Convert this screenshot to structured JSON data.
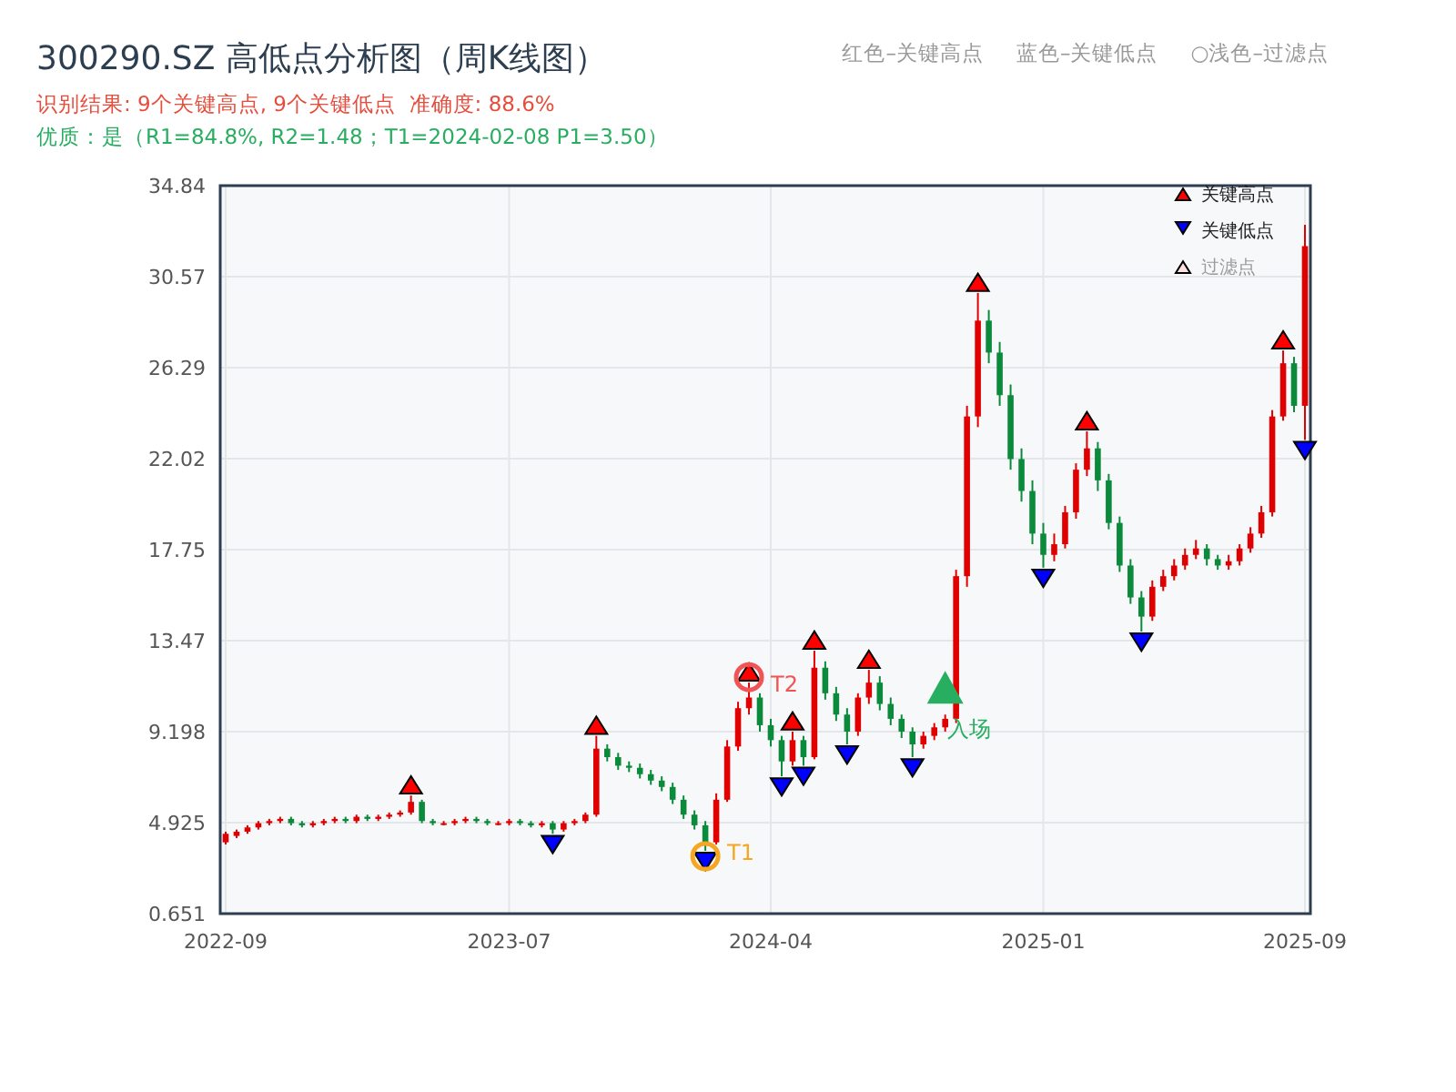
{
  "header": {
    "title": "300290.SZ 高低点分析图（周K线图）",
    "result": "识别结果: 9个关键高点, 9个关键低点  准确度: 88.6%",
    "quality": "优质：是（R1=84.8%, R2=1.48；T1=2024-02-08 P1=3.50）"
  },
  "hints": [
    {
      "label": "红色–关键高点"
    },
    {
      "label": "蓝色–关键低点"
    },
    {
      "label": "○浅色–过滤点"
    }
  ],
  "filtered_legend": {
    "label": "过滤点"
  },
  "chart_data": {
    "type": "candlestick",
    "ylim": [
      0.651,
      34.84
    ],
    "grid": true,
    "legend": "upper right",
    "categories": [
      "2022-09",
      null,
      null,
      null,
      null,
      null,
      null,
      null,
      null,
      null,
      null,
      null,
      null,
      null,
      null,
      null,
      null,
      null,
      null,
      null,
      null,
      null,
      null,
      null,
      null,
      null,
      "2023-07",
      null,
      null,
      null,
      null,
      null,
      null,
      null,
      null,
      null,
      null,
      null,
      null,
      null,
      null,
      null,
      null,
      null,
      null,
      null,
      null,
      null,
      null,
      null,
      "2024-04",
      null,
      null,
      null,
      null,
      null,
      null,
      null,
      null,
      null,
      null,
      null,
      null,
      null,
      null,
      null,
      null,
      null,
      null,
      null,
      null,
      null,
      null,
      null,
      null,
      "2025-01",
      null,
      null,
      null,
      null,
      null,
      null,
      null,
      null,
      null,
      null,
      null,
      null,
      null,
      null,
      null,
      null,
      null,
      null,
      null,
      null,
      null,
      null,
      null,
      "2025-09"
    ],
    "yticks": [
      0.651,
      4.925,
      9.198,
      13.47,
      17.75,
      22.02,
      26.29,
      30.57,
      34.84
    ],
    "ohlc": [
      [
        4.0,
        4.5,
        3.9,
        4.4
      ],
      [
        4.3,
        4.6,
        4.2,
        4.5
      ],
      [
        4.5,
        4.8,
        4.4,
        4.7
      ],
      [
        4.7,
        5.0,
        4.6,
        4.9
      ],
      [
        4.9,
        5.1,
        4.8,
        5.0
      ],
      [
        5.0,
        5.2,
        4.9,
        5.1
      ],
      [
        5.1,
        5.2,
        4.8,
        4.9
      ],
      [
        4.9,
        5.0,
        4.7,
        4.8
      ],
      [
        4.8,
        5.0,
        4.7,
        4.9
      ],
      [
        4.9,
        5.1,
        4.8,
        5.0
      ],
      [
        5.0,
        5.2,
        4.9,
        5.1
      ],
      [
        5.1,
        5.2,
        4.9,
        5.0
      ],
      [
        5.0,
        5.3,
        4.9,
        5.2
      ],
      [
        5.2,
        5.3,
        5.0,
        5.1
      ],
      [
        5.1,
        5.3,
        5.0,
        5.2
      ],
      [
        5.2,
        5.4,
        5.1,
        5.3
      ],
      [
        5.3,
        5.5,
        5.2,
        5.4
      ],
      [
        5.4,
        6.2,
        5.3,
        5.9
      ],
      [
        5.9,
        6.0,
        4.9,
        5.0
      ],
      [
        5.0,
        5.1,
        4.8,
        4.9
      ],
      [
        4.9,
        5.0,
        4.8,
        4.9
      ],
      [
        4.9,
        5.1,
        4.8,
        5.0
      ],
      [
        5.0,
        5.2,
        4.9,
        5.1
      ],
      [
        5.1,
        5.2,
        4.9,
        5.0
      ],
      [
        5.0,
        5.1,
        4.8,
        4.9
      ],
      [
        4.9,
        5.0,
        4.8,
        4.9
      ],
      [
        4.9,
        5.1,
        4.8,
        5.0
      ],
      [
        5.0,
        5.1,
        4.8,
        4.9
      ],
      [
        4.9,
        5.0,
        4.7,
        4.8
      ],
      [
        4.8,
        5.0,
        4.7,
        4.9
      ],
      [
        4.9,
        5.0,
        4.4,
        4.6
      ],
      [
        4.6,
        5.0,
        4.5,
        4.9
      ],
      [
        4.9,
        5.1,
        4.8,
        5.0
      ],
      [
        5.0,
        5.4,
        4.9,
        5.3
      ],
      [
        5.3,
        9.0,
        5.2,
        8.4
      ],
      [
        8.4,
        8.6,
        7.8,
        8.0
      ],
      [
        8.0,
        8.2,
        7.4,
        7.6
      ],
      [
        7.6,
        7.8,
        7.3,
        7.5
      ],
      [
        7.5,
        7.7,
        7.0,
        7.2
      ],
      [
        7.2,
        7.4,
        6.7,
        6.9
      ],
      [
        6.9,
        7.1,
        6.4,
        6.6
      ],
      [
        6.6,
        6.8,
        5.8,
        6.0
      ],
      [
        6.0,
        6.2,
        5.1,
        5.3
      ],
      [
        5.3,
        5.5,
        4.6,
        4.8
      ],
      [
        4.8,
        5.0,
        3.6,
        4.0
      ],
      [
        4.0,
        6.3,
        3.9,
        6.0
      ],
      [
        6.0,
        8.8,
        5.9,
        8.5
      ],
      [
        8.5,
        10.6,
        8.3,
        10.3
      ],
      [
        10.3,
        11.5,
        10.0,
        10.8
      ],
      [
        10.8,
        11.0,
        9.2,
        9.5
      ],
      [
        9.5,
        9.8,
        8.5,
        8.8
      ],
      [
        8.8,
        9.0,
        7.1,
        7.8
      ],
      [
        7.8,
        9.2,
        7.6,
        8.8
      ],
      [
        8.8,
        9.0,
        7.6,
        8.0
      ],
      [
        8.0,
        13.0,
        7.9,
        12.2
      ],
      [
        12.2,
        12.5,
        10.7,
        11.0
      ],
      [
        11.0,
        11.3,
        9.7,
        10.0
      ],
      [
        10.0,
        10.3,
        8.6,
        9.2
      ],
      [
        9.2,
        11.0,
        9.0,
        10.8
      ],
      [
        10.8,
        12.1,
        10.5,
        11.5
      ],
      [
        11.5,
        11.8,
        10.2,
        10.5
      ],
      [
        10.5,
        10.8,
        9.5,
        9.8
      ],
      [
        9.8,
        10.0,
        8.9,
        9.2
      ],
      [
        9.2,
        9.4,
        8.0,
        8.6
      ],
      [
        8.6,
        9.2,
        8.4,
        9.0
      ],
      [
        9.0,
        9.6,
        8.8,
        9.4
      ],
      [
        9.4,
        10.0,
        9.2,
        9.8
      ],
      [
        9.8,
        16.8,
        9.6,
        16.5
      ],
      [
        16.5,
        24.5,
        16.0,
        24.0
      ],
      [
        24.0,
        29.8,
        23.5,
        28.5
      ],
      [
        28.5,
        29.0,
        26.5,
        27.0
      ],
      [
        27.0,
        27.5,
        24.5,
        25.0
      ],
      [
        25.0,
        25.5,
        21.5,
        22.0
      ],
      [
        22.0,
        22.5,
        20.0,
        20.5
      ],
      [
        20.5,
        21.0,
        18.0,
        18.5
      ],
      [
        18.5,
        19.0,
        16.9,
        17.5
      ],
      [
        17.5,
        18.5,
        17.2,
        18.0
      ],
      [
        18.0,
        19.8,
        17.8,
        19.5
      ],
      [
        19.5,
        21.8,
        19.2,
        21.5
      ],
      [
        21.5,
        23.3,
        21.2,
        22.5
      ],
      [
        22.5,
        22.8,
        20.5,
        21.0
      ],
      [
        21.0,
        21.3,
        18.7,
        19.0
      ],
      [
        19.0,
        19.3,
        16.7,
        17.0
      ],
      [
        17.0,
        17.3,
        15.2,
        15.5
      ],
      [
        15.5,
        15.8,
        13.9,
        14.6
      ],
      [
        14.6,
        16.3,
        14.4,
        16.0
      ],
      [
        16.0,
        16.8,
        15.8,
        16.5
      ],
      [
        16.5,
        17.3,
        16.3,
        17.0
      ],
      [
        17.0,
        17.8,
        16.8,
        17.5
      ],
      [
        17.5,
        18.2,
        17.3,
        17.8
      ],
      [
        17.8,
        18.0,
        17.0,
        17.3
      ],
      [
        17.3,
        17.5,
        16.8,
        17.0
      ],
      [
        17.0,
        17.5,
        16.8,
        17.2
      ],
      [
        17.2,
        18.0,
        17.0,
        17.8
      ],
      [
        17.8,
        18.8,
        17.6,
        18.5
      ],
      [
        18.5,
        19.8,
        18.3,
        19.5
      ],
      [
        19.5,
        24.3,
        19.3,
        24.0
      ],
      [
        24.0,
        27.1,
        23.8,
        26.5
      ],
      [
        26.5,
        26.8,
        24.2,
        24.5
      ],
      [
        24.5,
        33.0,
        22.9,
        32.0
      ]
    ],
    "series": [
      {
        "name": "关键高点",
        "type": "scatter",
        "color": "#ff0000",
        "values": [
          null,
          null,
          null,
          null,
          null,
          null,
          null,
          null,
          null,
          null,
          null,
          null,
          null,
          null,
          null,
          null,
          null,
          6.7,
          null,
          null,
          null,
          null,
          null,
          null,
          null,
          null,
          null,
          null,
          null,
          null,
          null,
          null,
          null,
          null,
          9.5,
          null,
          null,
          null,
          null,
          null,
          null,
          null,
          null,
          null,
          null,
          null,
          null,
          null,
          12.0,
          null,
          null,
          null,
          9.7,
          null,
          13.5,
          null,
          null,
          null,
          null,
          12.6,
          null,
          null,
          null,
          null,
          null,
          null,
          null,
          null,
          null,
          30.3,
          null,
          null,
          null,
          null,
          null,
          null,
          null,
          null,
          null,
          23.8,
          null,
          null,
          null,
          null,
          null,
          null,
          null,
          null,
          null,
          null,
          null,
          null,
          null,
          null,
          null,
          null,
          null,
          27.6,
          null,
          null
        ]
      },
      {
        "name": "关键低点",
        "type": "scatter",
        "color": "#0000ff",
        "values": [
          null,
          null,
          null,
          null,
          null,
          null,
          null,
          null,
          null,
          null,
          null,
          null,
          null,
          null,
          null,
          null,
          null,
          null,
          null,
          null,
          null,
          null,
          null,
          null,
          null,
          null,
          null,
          null,
          null,
          null,
          3.9,
          null,
          null,
          null,
          null,
          null,
          null,
          null,
          null,
          null,
          null,
          null,
          null,
          null,
          3.1,
          null,
          null,
          null,
          null,
          null,
          null,
          6.6,
          null,
          7.1,
          null,
          null,
          null,
          8.1,
          null,
          null,
          null,
          null,
          null,
          7.5,
          null,
          null,
          null,
          null,
          null,
          null,
          null,
          null,
          null,
          null,
          null,
          16.4,
          null,
          null,
          null,
          null,
          null,
          null,
          null,
          null,
          13.4,
          null,
          null,
          null,
          null,
          null,
          null,
          null,
          null,
          null,
          null,
          null,
          null,
          null,
          null,
          22.4
        ]
      }
    ],
    "annotations": [
      "T1",
      "T2",
      "入场"
    ]
  }
}
